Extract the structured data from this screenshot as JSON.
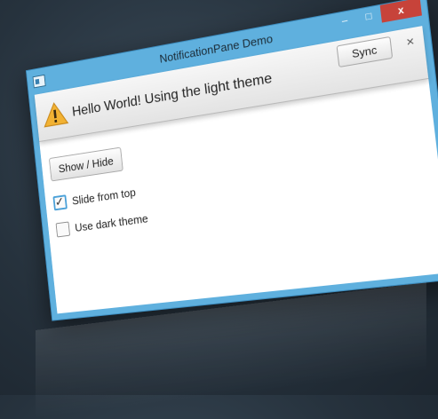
{
  "window": {
    "title": "NotificationPane Demo",
    "controls": {
      "minimize": "–",
      "maximize": "□",
      "close": "x"
    }
  },
  "notification": {
    "icon": "warning-icon",
    "text": "Hello World! Using the light theme",
    "sync_label": "Sync",
    "close_label": "×"
  },
  "content": {
    "show_hide_label": "Show / Hide",
    "slide_from_top": {
      "label": "Slide from top",
      "checked": true
    },
    "dark_theme": {
      "label": "Use dark theme",
      "checked": false
    }
  },
  "colors": {
    "frame": "#5fb0de",
    "close_button": "#c7433a",
    "checkbox_focus": "#49a0d8",
    "warning": "#f2b233"
  }
}
